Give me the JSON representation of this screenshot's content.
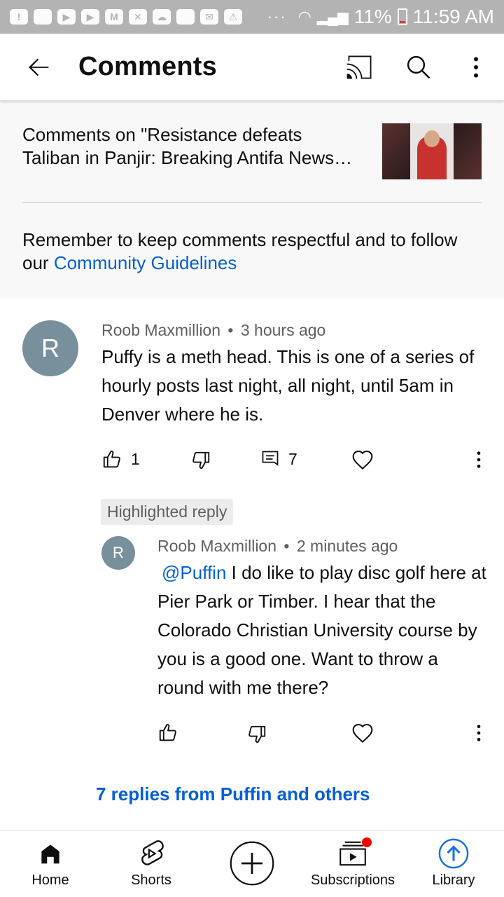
{
  "status_bar": {
    "battery": "11%",
    "time": "11:59 AM"
  },
  "app_bar": {
    "title": "Comments"
  },
  "header": {
    "video_title_line1": "Comments on \"Resistance defeats",
    "video_title_line2": "Taliban in Panjir: Breaking Antifa News…",
    "guidelines_text": "Remember to keep comments respectful and to follow our ",
    "guidelines_link": "Community Guidelines"
  },
  "comment": {
    "avatar_letter": "R",
    "author": "Roob Maxmillion",
    "separator": "•",
    "time": "3 hours ago",
    "text": "Puffy is a meth head. This is one of a series of hourly posts last night, all night, until 5am in Denver where he is.",
    "likes": "1",
    "replies": "7"
  },
  "highlighted_label": "Highlighted reply",
  "reply": {
    "avatar_letter": "R",
    "author": "Roob Maxmillion",
    "separator": "•",
    "time": "2 minutes ago",
    "mention": "@Puffin",
    "text": " I do like to play disc golf here at Pier Park or Timber.  I hear that the Colorado Christian University course by you is a good one. Want to throw a round with me there?"
  },
  "more_replies": "7 replies from Puffin and others",
  "bottom_nav": {
    "home": "Home",
    "shorts": "Shorts",
    "subscriptions": "Subscriptions",
    "library": "Library"
  },
  "colors": {
    "link": "#065fd4",
    "avatar": "#78909c",
    "notification_dot": "#ff0000"
  }
}
